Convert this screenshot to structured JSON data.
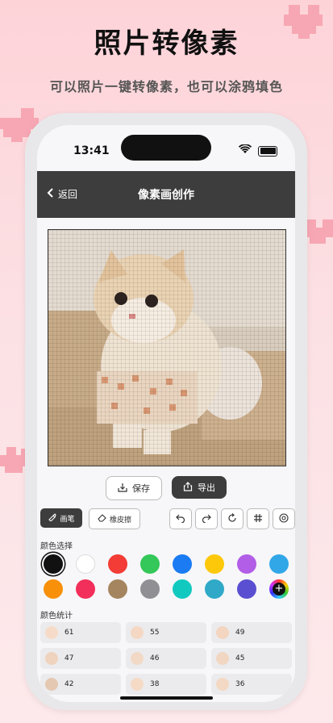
{
  "marketing": {
    "headline": "照片转像素",
    "subline": "可以照片一键转像素，也可以涂鸦填色"
  },
  "status_bar": {
    "time": "13:41"
  },
  "nav": {
    "back_label": "返回",
    "title": "像素画创作"
  },
  "actions": {
    "save_label": "保存",
    "export_label": "导出"
  },
  "tools": {
    "pen_label": "画笔",
    "eraser_label": "橡皮擦",
    "icons": [
      "undo-icon",
      "redo-icon",
      "refresh-icon",
      "grid-icon",
      "target-icon"
    ]
  },
  "palette": {
    "label": "颜色选择",
    "selected_index": 0,
    "colors": [
      "#111111",
      "#ffffff",
      "#f23c35",
      "#34c759",
      "#1a7bf2",
      "#fdc80a",
      "#b25ee6",
      "#32a7e8",
      "#f8900a",
      "#f22e5a",
      "#a5855f",
      "#8f8f94",
      "#12c9c0",
      "#2fa9c7",
      "#5a4fd1",
      "custom"
    ]
  },
  "stats": {
    "label": "颜色统计",
    "items": [
      {
        "count": "61",
        "color": "#f6dcc8"
      },
      {
        "count": "55",
        "color": "#f4d8c4"
      },
      {
        "count": "49",
        "color": "#f3d5c0"
      },
      {
        "count": "47",
        "color": "#efd3be"
      },
      {
        "count": "46",
        "color": "#f2d9c6"
      },
      {
        "count": "45",
        "color": "#f1d6c2"
      },
      {
        "count": "42",
        "color": "#e4c8b2"
      },
      {
        "count": "38",
        "color": "#f5dac6"
      },
      {
        "count": "36",
        "color": "#f3d8c3"
      }
    ]
  }
}
